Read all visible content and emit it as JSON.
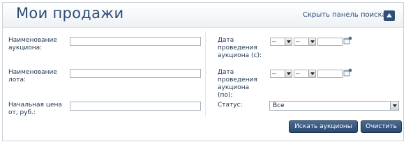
{
  "header": {
    "title": "Мои продажи",
    "hide_panel_link": "Скрыть панель поиска"
  },
  "form": {
    "auction_name_label": "Наименование аукциона:",
    "lot_name_label": "Наименование лота:",
    "start_price_label": "Начальная цена от, руб.:",
    "date_from_label": "Дата проведения аукциона (с):",
    "date_to_label": "Дата проведения аукциона (по):",
    "status_label": "Статус:",
    "date_from": {
      "day": "--",
      "month": "--"
    },
    "date_to": {
      "day": "--",
      "month": "--"
    },
    "status_value": "Все"
  },
  "buttons": {
    "search": "Искать аукционы",
    "clear": "Очистить"
  },
  "colors": {
    "title": "#2d4c78",
    "button_bg": "#2f4f77",
    "border": "#cdd3da"
  },
  "icons": {
    "hide_panel": "triangle-up-icon",
    "calendar": "calendar-icon"
  }
}
